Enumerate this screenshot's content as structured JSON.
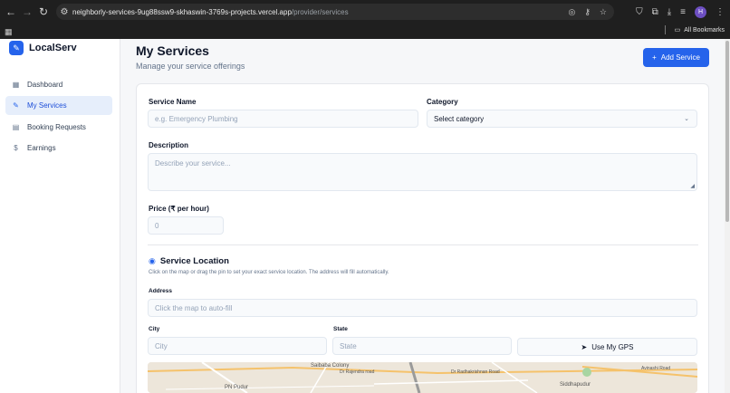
{
  "browser": {
    "url_host": "neighborly-services-9ug88ssw9-skhaswin-3769s-projects.vercel.app",
    "url_path": "/provider/services",
    "bookmarks_label": "All Bookmarks",
    "profile_initial": "H"
  },
  "sidebar": {
    "brand": "LocalServ",
    "items": [
      {
        "label": "Dashboard",
        "icon": "grid-icon",
        "active": false
      },
      {
        "label": "My Services",
        "icon": "wrench-icon",
        "active": true
      },
      {
        "label": "Booking Requests",
        "icon": "clipboard-icon",
        "active": false
      },
      {
        "label": "Earnings",
        "icon": "dollar-icon",
        "active": false
      }
    ]
  },
  "header": {
    "title": "My Services",
    "subtitle": "Manage your service offerings",
    "add_button": "Add Service"
  },
  "form": {
    "service_name_label": "Service Name",
    "service_name_placeholder": "e.g. Emergency Plumbing",
    "category_label": "Category",
    "category_value": "Select category",
    "description_label": "Description",
    "description_placeholder": "Describe your service...",
    "price_label": "Price (₹ per hour)",
    "price_value": "0",
    "location_title": "Service Location",
    "location_desc": "Click on the map or drag the pin to set your exact service location. The address will fill automatically.",
    "address_label": "Address",
    "address_placeholder": "Click the map to auto-fill",
    "city_label": "City",
    "city_placeholder": "City",
    "state_label": "State",
    "state_placeholder": "State",
    "gps_button": "Use My GPS"
  },
  "map": {
    "labels": [
      "Saibaba Colony",
      "Dr Rajendra road",
      "Dr Radhakrishnan Road",
      "Siddhapudur",
      "PN Pudur",
      "Avinashi Road"
    ]
  },
  "colors": {
    "accent": "#2563eb",
    "active_bg": "#e6eefb"
  }
}
